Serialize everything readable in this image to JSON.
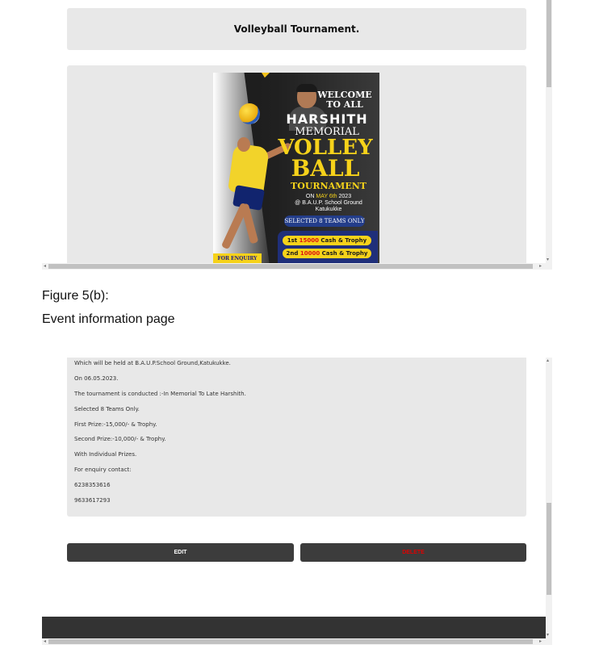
{
  "top_screen": {
    "event_title": "Volleyball Tournament.",
    "poster": {
      "welcome_line1": "WELCOME",
      "welcome_line2": "TO ALL",
      "name": "HARSHITH",
      "memorial": "MEMORIAL",
      "word1": "VOLLEY",
      "word2": "BALL",
      "word3": "TOURNAMENT",
      "date_prefix": "ON",
      "date_highlight": "MAY 6th",
      "date_year": "2023",
      "venue_line1": "@ B.A.U.P. School Ground",
      "venue_line2": "Katukukke",
      "teams_badge": "SELECTED 8 TEAMS ONLY",
      "prize1_rank": "1st",
      "prize1_amount": "15000",
      "prize1_text": "Cash & Trophy",
      "prize2_rank": "2nd",
      "prize2_amount": "10000",
      "prize2_text": "Cash & Trophy",
      "enquiry": "FOR ENQUIRY"
    }
  },
  "captions": {
    "figure": "Figure 5(b):",
    "page_name": "Event information page"
  },
  "bottom_screen": {
    "details": [
      "Which will be held at B.A.U.P.School Ground,Katukukke.",
      "On 06.05.2023.",
      "The tournament is conducted :-In Memorial To Late Harshith.",
      "Selected 8 Teams Only.",
      "First Prize:-15,000/- & Trophy.",
      "Second Prize:-10,000/- & Trophy.",
      "With Individual Prizes.",
      "For enquiry contact:",
      "6238353616",
      "9633617293"
    ],
    "edit_label": "EDIT",
    "delete_label": "DELETE"
  },
  "colors": {
    "card_bg": "#e8e8e8",
    "button_bg": "#3c3c3c",
    "delete_text": "#e00000",
    "footer_bg": "#333333",
    "poster_yellow": "#f6d21a"
  }
}
